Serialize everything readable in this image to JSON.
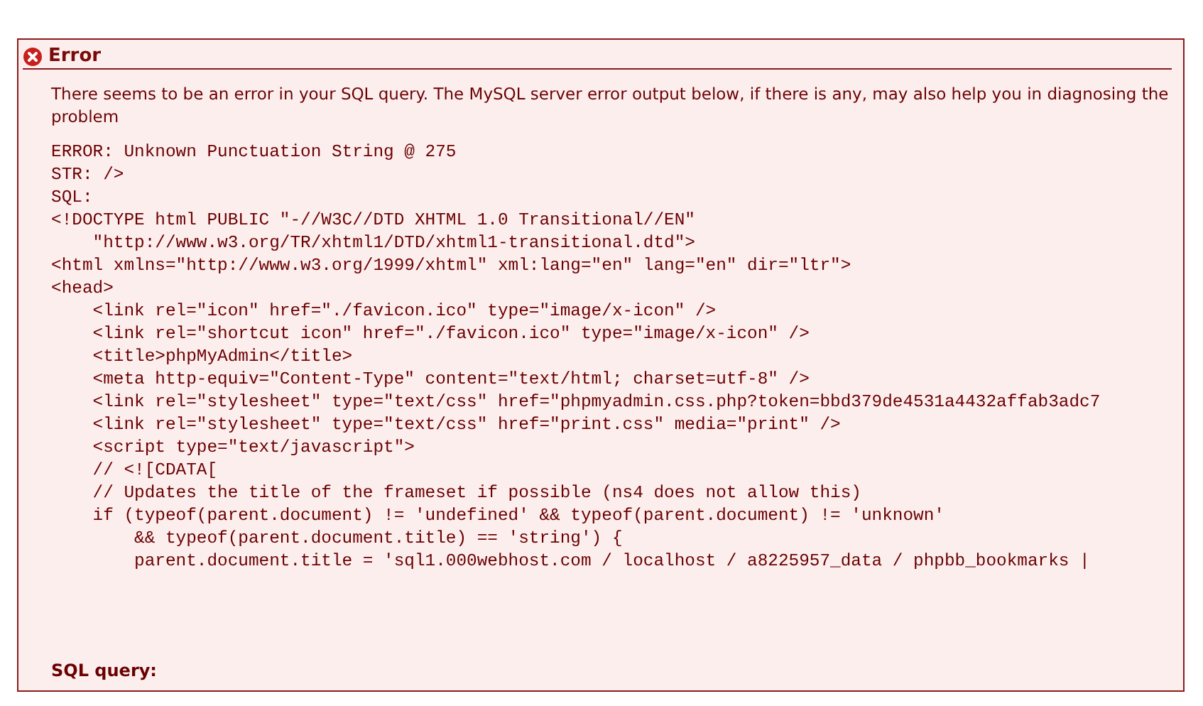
{
  "error_box": {
    "title": "Error",
    "message": "There seems to be an error in your SQL query. The MySQL server error output below, if there is any, may also help you in diagnosing the problem",
    "output_lines": [
      "ERROR: Unknown Punctuation String @ 275",
      "STR: />",
      "SQL:",
      "<!DOCTYPE html PUBLIC \"-//W3C//DTD XHTML 1.0 Transitional//EN\"",
      "    \"http://www.w3.org/TR/xhtml1/DTD/xhtml1-transitional.dtd\">",
      "<html xmlns=\"http://www.w3.org/1999/xhtml\" xml:lang=\"en\" lang=\"en\" dir=\"ltr\">",
      "<head>",
      "    <link rel=\"icon\" href=\"./favicon.ico\" type=\"image/x-icon\" />",
      "    <link rel=\"shortcut icon\" href=\"./favicon.ico\" type=\"image/x-icon\" />",
      "    <title>phpMyAdmin</title>",
      "    <meta http-equiv=\"Content-Type\" content=\"text/html; charset=utf-8\" />",
      "    <link rel=\"stylesheet\" type=\"text/css\" href=\"phpmyadmin.css.php?token=bbd379de4531a4432affab3adc7",
      "    <link rel=\"stylesheet\" type=\"text/css\" href=\"print.css\" media=\"print\" />",
      "    <script type=\"text/javascript\">",
      "    // <![CDATA[",
      "    // Updates the title of the frameset if possible (ns4 does not allow this)",
      "    if (typeof(parent.document) != 'undefined' && typeof(parent.document) != 'unknown'",
      "        && typeof(parent.document.title) == 'string') {",
      "        parent.document.title = 'sql1.000webhost.com / localhost / a8225957_data / phpbb_bookmarks |"
    ],
    "sql_query_label": "SQL query:"
  }
}
